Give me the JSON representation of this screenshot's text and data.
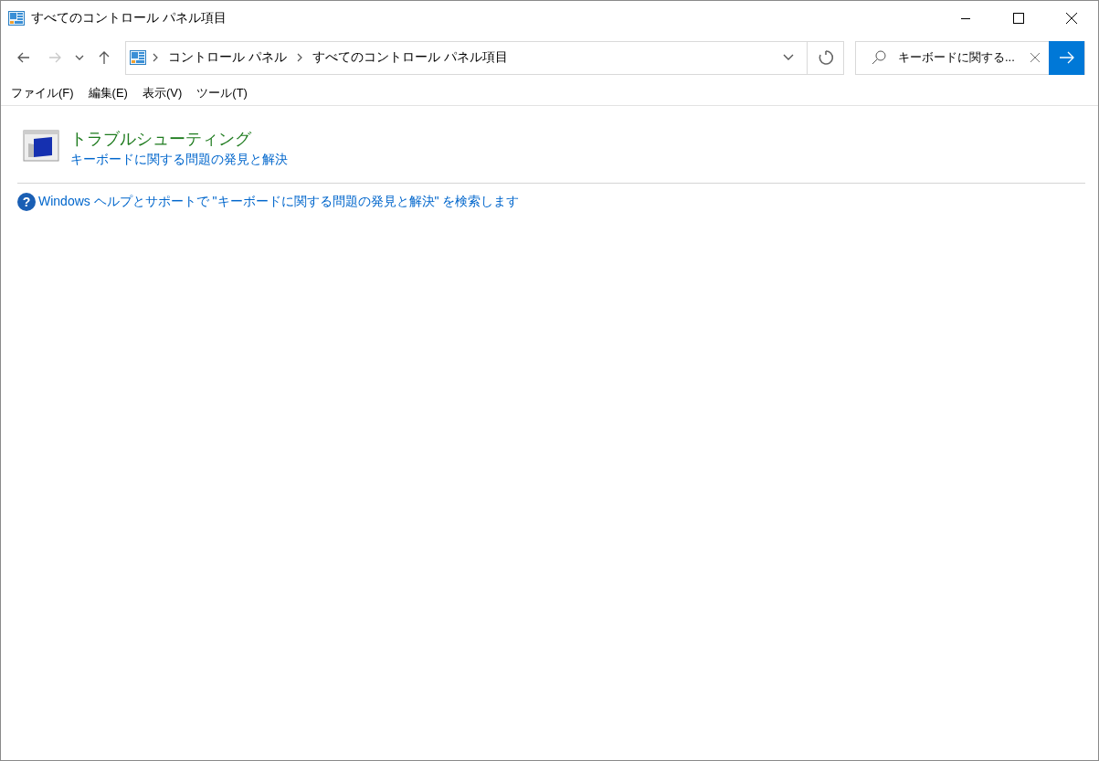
{
  "window": {
    "title": "すべてのコントロール パネル項目"
  },
  "nav_buttons": [
    {
      "kind": "back",
      "disabled": false
    },
    {
      "kind": "forward",
      "disabled": true
    },
    {
      "kind": "recent",
      "disabled": false
    },
    {
      "kind": "up",
      "disabled": false
    }
  ],
  "address_bar": {
    "crumbs": [
      "コントロール パネル",
      "すべてのコントロール パネル項目"
    ]
  },
  "search": {
    "value": "キーボードに関する..."
  },
  "menu": [
    "ファイル(F)",
    "編集(E)",
    "表示(V)",
    "ツール(T)"
  ],
  "results": [
    {
      "title": "トラブルシューティング",
      "link": "キーボードに関する問題の発見と解決"
    }
  ],
  "help_icon": "?",
  "help_link": "Windows ヘルプとサポートで \"キーボードに関する問題の発見と解決\" を検索します"
}
